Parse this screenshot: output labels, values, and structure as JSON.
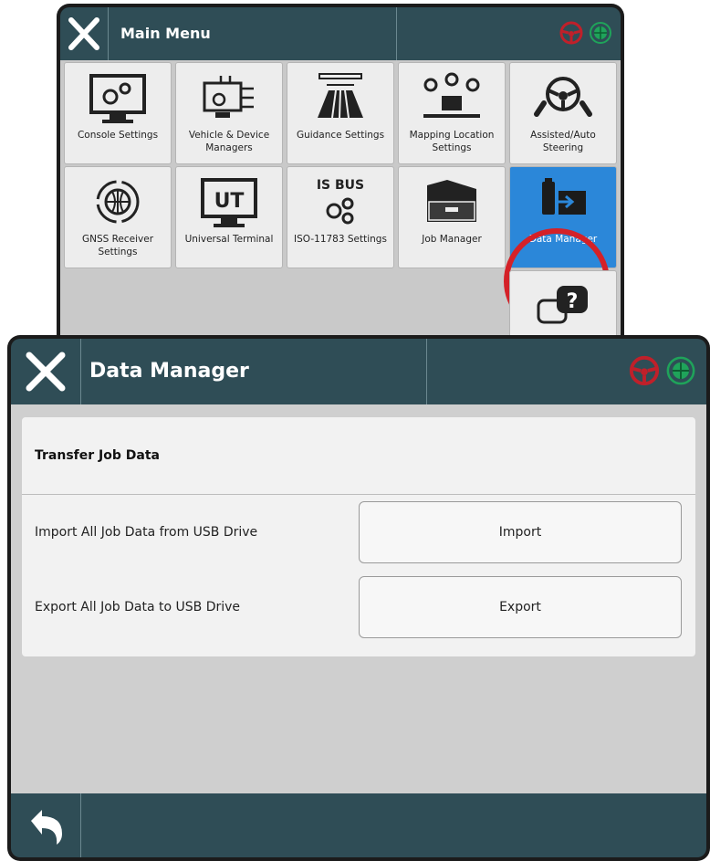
{
  "main_menu": {
    "title": "Main Menu",
    "tiles": [
      {
        "label": "Console Settings",
        "icon": "console-settings-icon"
      },
      {
        "label": "Vehicle & Device Managers",
        "icon": "vehicle-device-icon"
      },
      {
        "label": "Guidance Settings",
        "icon": "guidance-icon"
      },
      {
        "label": "Mapping Location Settings",
        "icon": "mapping-location-icon"
      },
      {
        "label": "Assisted/Auto Steering",
        "icon": "steering-wheel-icon"
      },
      {
        "label": "GNSS Receiver Settings",
        "icon": "gnss-receiver-icon"
      },
      {
        "label": "Universal Terminal",
        "icon": "universal-terminal-icon"
      },
      {
        "label": "ISO-11783 Settings",
        "icon": "isobus-icon"
      },
      {
        "label": "Job Manager",
        "icon": "job-manager-icon"
      },
      {
        "label": "Data Manager",
        "icon": "data-manager-icon"
      }
    ],
    "isobus_logo": "IS BUS",
    "ut_logo": "UT",
    "selected": "Data Manager"
  },
  "data_manager": {
    "title": "Data Manager",
    "section_title": "Transfer Job Data",
    "import_label": "Import All Job Data from USB Drive",
    "import_button": "Import",
    "export_label": "Export All Job Data to USB Drive",
    "export_button": "Export"
  },
  "colors": {
    "header": "#2f4d56",
    "selected_tile": "#2b87d9",
    "highlight": "#d42128",
    "steering_status": "#c0202a",
    "gnss_status": "#1fa35a"
  }
}
